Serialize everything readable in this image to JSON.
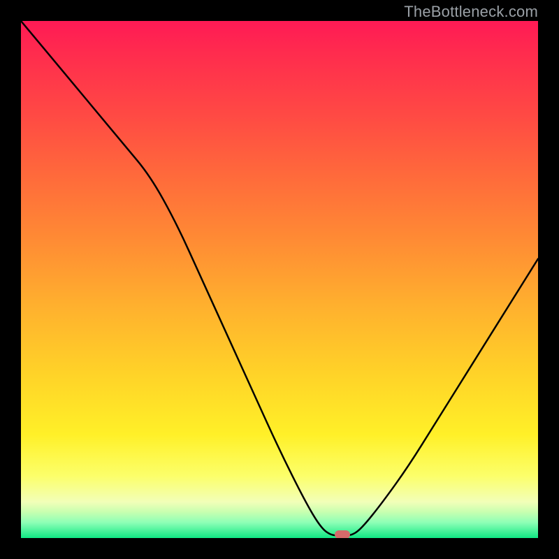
{
  "watermark": "TheBottleneck.com",
  "marker": {
    "x_pct": 62.2,
    "y_pct": 99.3
  },
  "chart_data": {
    "type": "line",
    "title": "",
    "xlabel": "",
    "ylabel": "",
    "xlim": [
      0,
      100
    ],
    "ylim": [
      0,
      100
    ],
    "grid": false,
    "legend": false,
    "series": [
      {
        "name": "bottleneck-curve",
        "x": [
          0,
          5,
          10,
          15,
          20,
          25,
          30,
          35,
          40,
          45,
          50,
          55,
          58,
          60,
          62,
          64,
          66,
          70,
          75,
          80,
          85,
          90,
          95,
          100
        ],
        "values": [
          100,
          94,
          88,
          82,
          76,
          70,
          61,
          50,
          39,
          28,
          17,
          7,
          2,
          0.5,
          0.5,
          0.5,
          2,
          7,
          14,
          22,
          30,
          38,
          46,
          54
        ]
      }
    ],
    "annotations": [
      {
        "type": "marker",
        "x": 62.2,
        "y": 0.7,
        "shape": "pill",
        "color": "#d46a6a"
      }
    ],
    "background_gradient": [
      {
        "stop": 0.0,
        "color": "#ff1a55"
      },
      {
        "stop": 0.8,
        "color": "#fff028"
      },
      {
        "stop": 1.0,
        "color": "#10e884"
      }
    ]
  }
}
